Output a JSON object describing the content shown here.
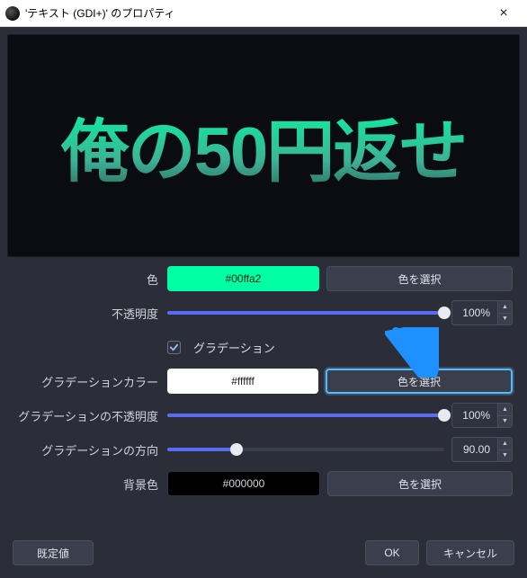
{
  "window": {
    "title": "'テキスト (GDI+)' のプロパティ"
  },
  "preview": {
    "text": "俺の50円返せ"
  },
  "props": {
    "color": {
      "label": "色",
      "value": "#00ffa2",
      "choose": "色を選択"
    },
    "opacity": {
      "label": "不透明度",
      "value": 100,
      "suffix": "%"
    },
    "gradient_checkbox": {
      "label": "グラデーション",
      "checked": true
    },
    "gradient_color": {
      "label": "グラデーションカラー",
      "value": "#ffffff",
      "choose": "色を選択"
    },
    "gradient_opacity": {
      "label": "グラデーションの不透明度",
      "value": 100,
      "suffix": "%"
    },
    "gradient_direction": {
      "label": "グラデーションの方向",
      "value": "90.00"
    },
    "bg_color": {
      "label": "背景色",
      "value": "#000000",
      "choose": "色を選択"
    }
  },
  "footer": {
    "defaults": "既定値",
    "ok": "OK",
    "cancel": "キャンセル"
  }
}
